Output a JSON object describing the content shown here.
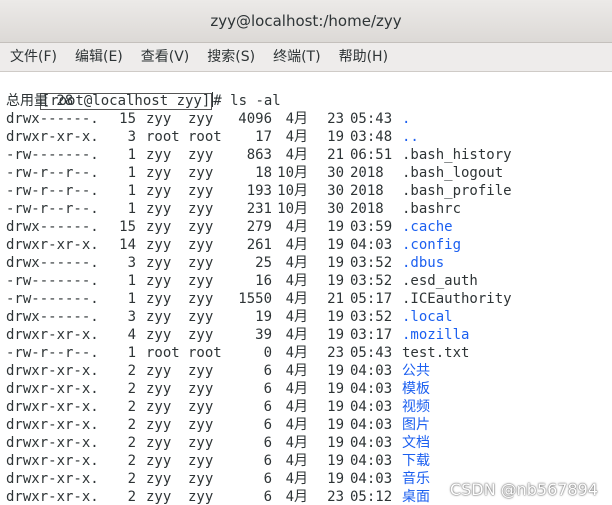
{
  "window": {
    "title": "zyy@localhost:/home/zyy"
  },
  "menu": [
    "文件(F)",
    "编辑(E)",
    "查看(V)",
    "搜索(S)",
    "终端(T)",
    "帮助(H)"
  ],
  "terminal": {
    "prompt": "[root@localhost zyy]",
    "command": "# ls -al",
    "total_line": "总用量 28",
    "files": [
      {
        "perm": "drwx------.",
        "links": "15",
        "owner": "zyy",
        "group": "zyy",
        "size": "4096",
        "month": "4月",
        "day": "23",
        "time": "05:43",
        "name": ".",
        "is_dir": true
      },
      {
        "perm": "drwxr-xr-x.",
        "links": "3",
        "owner": "root",
        "group": "root",
        "size": "17",
        "month": "4月",
        "day": "19",
        "time": "03:48",
        "name": "..",
        "is_dir": true
      },
      {
        "perm": "-rw-------.",
        "links": "1",
        "owner": "zyy",
        "group": "zyy",
        "size": "863",
        "month": "4月",
        "day": "21",
        "time": "06:51",
        "name": ".bash_history",
        "is_dir": false
      },
      {
        "perm": "-rw-r--r--.",
        "links": "1",
        "owner": "zyy",
        "group": "zyy",
        "size": "18",
        "month": "10月",
        "day": "30",
        "time": "2018",
        "name": ".bash_logout",
        "is_dir": false
      },
      {
        "perm": "-rw-r--r--.",
        "links": "1",
        "owner": "zyy",
        "group": "zyy",
        "size": "193",
        "month": "10月",
        "day": "30",
        "time": "2018",
        "name": ".bash_profile",
        "is_dir": false
      },
      {
        "perm": "-rw-r--r--.",
        "links": "1",
        "owner": "zyy",
        "group": "zyy",
        "size": "231",
        "month": "10月",
        "day": "30",
        "time": "2018",
        "name": ".bashrc",
        "is_dir": false
      },
      {
        "perm": "drwx------.",
        "links": "15",
        "owner": "zyy",
        "group": "zyy",
        "size": "279",
        "month": "4月",
        "day": "19",
        "time": "03:59",
        "name": ".cache",
        "is_dir": true
      },
      {
        "perm": "drwxr-xr-x.",
        "links": "14",
        "owner": "zyy",
        "group": "zyy",
        "size": "261",
        "month": "4月",
        "day": "19",
        "time": "04:03",
        "name": ".config",
        "is_dir": true
      },
      {
        "perm": "drwx------.",
        "links": "3",
        "owner": "zyy",
        "group": "zyy",
        "size": "25",
        "month": "4月",
        "day": "19",
        "time": "03:52",
        "name": ".dbus",
        "is_dir": true
      },
      {
        "perm": "-rw-------.",
        "links": "1",
        "owner": "zyy",
        "group": "zyy",
        "size": "16",
        "month": "4月",
        "day": "19",
        "time": "03:52",
        "name": ".esd_auth",
        "is_dir": false
      },
      {
        "perm": "-rw-------.",
        "links": "1",
        "owner": "zyy",
        "group": "zyy",
        "size": "1550",
        "month": "4月",
        "day": "21",
        "time": "05:17",
        "name": ".ICEauthority",
        "is_dir": false
      },
      {
        "perm": "drwx------.",
        "links": "3",
        "owner": "zyy",
        "group": "zyy",
        "size": "19",
        "month": "4月",
        "day": "19",
        "time": "03:52",
        "name": ".local",
        "is_dir": true
      },
      {
        "perm": "drwxr-xr-x.",
        "links": "4",
        "owner": "zyy",
        "group": "zyy",
        "size": "39",
        "month": "4月",
        "day": "19",
        "time": "03:17",
        "name": ".mozilla",
        "is_dir": true
      },
      {
        "perm": "-rw-r--r--.",
        "links": "1",
        "owner": "root",
        "group": "root",
        "size": "0",
        "month": "4月",
        "day": "23",
        "time": "05:43",
        "name": "test.txt",
        "is_dir": false
      },
      {
        "perm": "drwxr-xr-x.",
        "links": "2",
        "owner": "zyy",
        "group": "zyy",
        "size": "6",
        "month": "4月",
        "day": "19",
        "time": "04:03",
        "name": "公共",
        "is_dir": true
      },
      {
        "perm": "drwxr-xr-x.",
        "links": "2",
        "owner": "zyy",
        "group": "zyy",
        "size": "6",
        "month": "4月",
        "day": "19",
        "time": "04:03",
        "name": "模板",
        "is_dir": true
      },
      {
        "perm": "drwxr-xr-x.",
        "links": "2",
        "owner": "zyy",
        "group": "zyy",
        "size": "6",
        "month": "4月",
        "day": "19",
        "time": "04:03",
        "name": "视频",
        "is_dir": true
      },
      {
        "perm": "drwxr-xr-x.",
        "links": "2",
        "owner": "zyy",
        "group": "zyy",
        "size": "6",
        "month": "4月",
        "day": "19",
        "time": "04:03",
        "name": "图片",
        "is_dir": true
      },
      {
        "perm": "drwxr-xr-x.",
        "links": "2",
        "owner": "zyy",
        "group": "zyy",
        "size": "6",
        "month": "4月",
        "day": "19",
        "time": "04:03",
        "name": "文档",
        "is_dir": true
      },
      {
        "perm": "drwxr-xr-x.",
        "links": "2",
        "owner": "zyy",
        "group": "zyy",
        "size": "6",
        "month": "4月",
        "day": "19",
        "time": "04:03",
        "name": "下载",
        "is_dir": true
      },
      {
        "perm": "drwxr-xr-x.",
        "links": "2",
        "owner": "zyy",
        "group": "zyy",
        "size": "6",
        "month": "4月",
        "day": "19",
        "time": "04:03",
        "name": "音乐",
        "is_dir": true
      },
      {
        "perm": "drwxr-xr-x.",
        "links": "2",
        "owner": "zyy",
        "group": "zyy",
        "size": "6",
        "month": "4月",
        "day": "23",
        "time": "05:12",
        "name": "桌面",
        "is_dir": true
      }
    ]
  },
  "watermark": "CSDN @nb567894",
  "colors": {
    "dir": "#1b5ff0",
    "text": "#2e3436"
  }
}
